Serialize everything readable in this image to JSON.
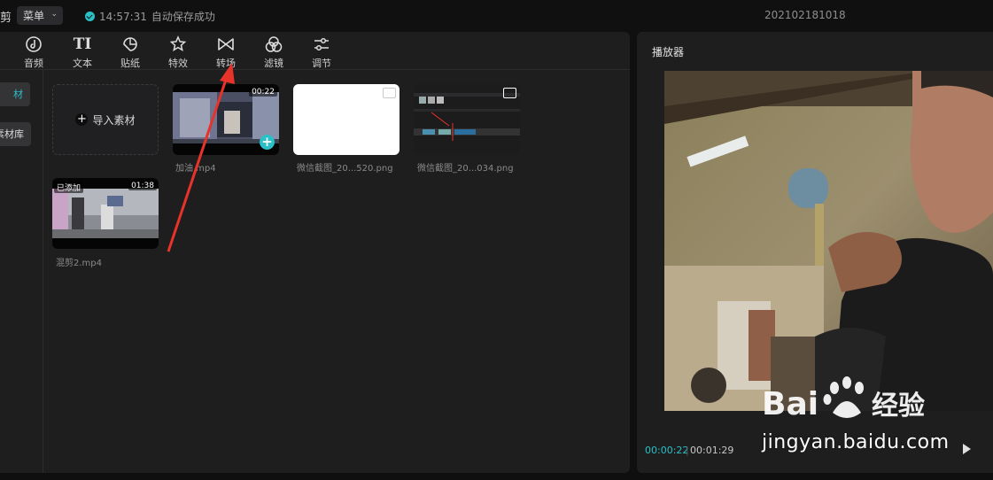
{
  "topbar": {
    "app_glyph": "剪",
    "menu_label": "菜单",
    "save_time": "14:57:31",
    "save_text": "自动保存成功",
    "project_title": "202102181018"
  },
  "toolbar": {
    "tools": [
      {
        "label": "音频",
        "icon": "audio-icon"
      },
      {
        "label": "文本",
        "icon": "text-icon"
      },
      {
        "label": "贴纸",
        "icon": "sticker-icon"
      },
      {
        "label": "特效",
        "icon": "effects-icon"
      },
      {
        "label": "转场",
        "icon": "transition-icon"
      },
      {
        "label": "滤镜",
        "icon": "filter-icon"
      },
      {
        "label": "调节",
        "icon": "adjust-icon"
      }
    ],
    "text_glyph": "TI"
  },
  "sidebar": {
    "items": [
      {
        "label": "材",
        "active": true
      },
      {
        "label": "素材库",
        "active": false
      }
    ]
  },
  "media": {
    "import_label": "导入素材",
    "items": [
      {
        "name": "加油.mp4",
        "duration": "00:22",
        "type": "video"
      },
      {
        "name": "微信截图_20...520.png",
        "type": "image"
      },
      {
        "name": "微信截图_20...034.png",
        "type": "image"
      },
      {
        "name": "混剪2.mp4",
        "duration": "01:38",
        "badge": "已添加",
        "type": "video"
      }
    ]
  },
  "player": {
    "title": "播放器",
    "current_time": "00:00:22",
    "total_time": "00:01:29",
    "separator": "|"
  },
  "watermark": {
    "brand": "Baidu 经验",
    "url": "jingyan.baidu.com"
  },
  "colors": {
    "accent": "#29c0c7",
    "arrow": "#e8332a",
    "panel": "#1e1e1f",
    "background": "#0f0f10"
  }
}
